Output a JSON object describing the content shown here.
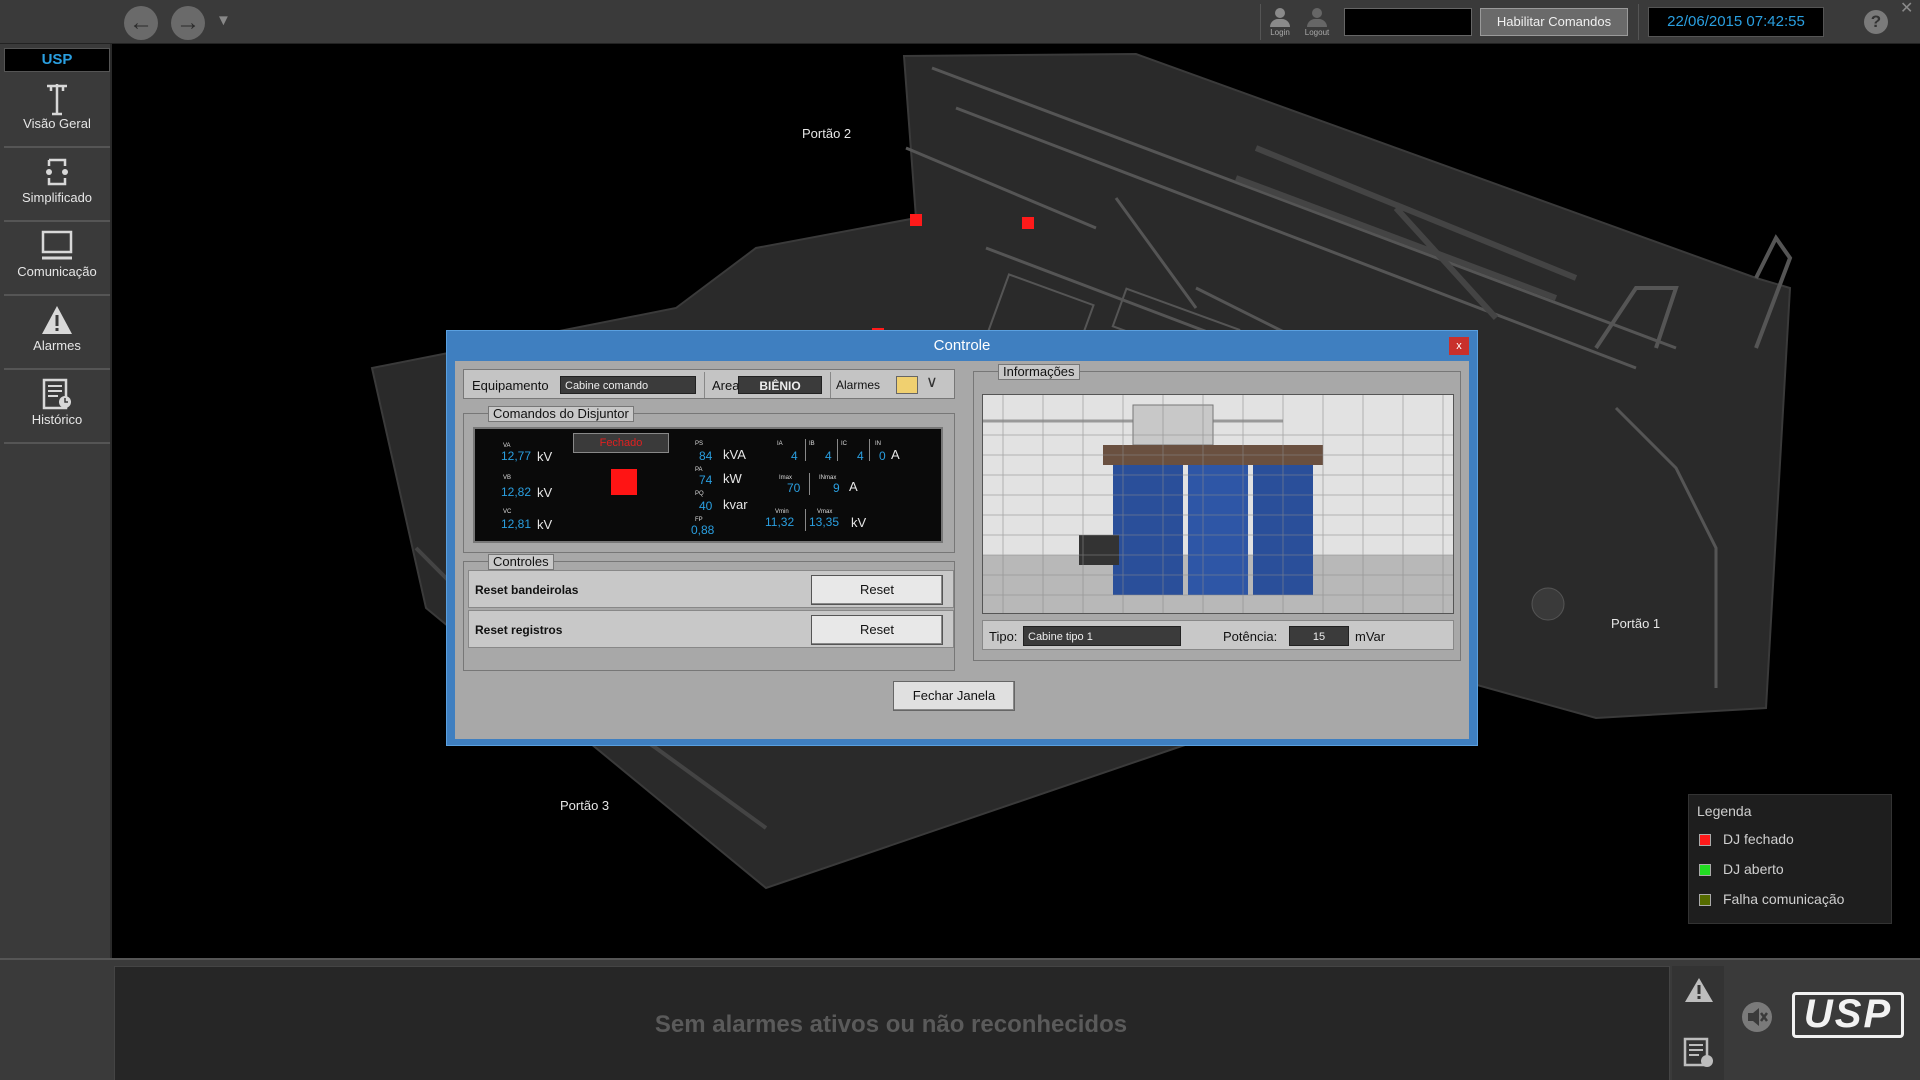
{
  "topbar": {
    "login_label": "Login",
    "logout_label": "Logout",
    "user_field_value": "",
    "habilitar_label": "Habilitar Comandos",
    "datetime": "22/06/2015 07:42:55",
    "help_label": "?"
  },
  "sidebar": {
    "area": "USP",
    "items": [
      {
        "label": "Visão Geral",
        "icon": "tower-icon"
      },
      {
        "label": "Simplificado",
        "icon": "diagram-icon"
      },
      {
        "label": "Comunicação",
        "icon": "monitor-icon"
      },
      {
        "label": "Alarmes",
        "icon": "warning-icon"
      },
      {
        "label": "Histórico",
        "icon": "history-icon"
      }
    ]
  },
  "map": {
    "labels": {
      "portao1": "Portão 1",
      "portao2": "Portão 2",
      "portao3": "Portão 3"
    },
    "closed_breaker_color": "#ff1a1a"
  },
  "legend": {
    "title": "Legenda",
    "items": [
      {
        "label": "DJ fechado",
        "color": "#ff1a1a"
      },
      {
        "label": "DJ aberto",
        "color": "#22dd22"
      },
      {
        "label": "Falha comunicação",
        "color": "#556b00"
      }
    ]
  },
  "dialog": {
    "title": "Controle",
    "close_label": "x",
    "equipamento_label": "Equipamento",
    "equipamento_value": "Cabine comando",
    "area_label": "Area",
    "area_value": "BIÊNIO",
    "alarmes_label": "Alarmes",
    "comandos_title": "Comandos do Disjuntor",
    "breaker_state": "Fechado",
    "measurements": {
      "va_label": "VA",
      "va": "12,77",
      "va_unit": "kV",
      "vb_label": "VB",
      "vb": "12,82",
      "vb_unit": "kV",
      "vc_label": "VC",
      "vc": "12,81",
      "vc_unit": "kV",
      "ps_label": "PS",
      "ps": "84",
      "ps_unit": "kVA",
      "pa_label": "PA",
      "pa": "74",
      "pa_unit": "kW",
      "pq_label": "PQ",
      "pq": "40",
      "pq_unit": "kvar",
      "fp_label": "FP",
      "fp": "0,88",
      "ia_label": "IA",
      "ia": "4",
      "ib_label": "IB",
      "ib": "4",
      "ic_label": "IC",
      "ic": "4",
      "in_label": "IN",
      "in": "0",
      "i_unit": "A",
      "imax_label": "Imax",
      "imax": "70",
      "inmax_label": "INmax",
      "inmax": "9",
      "imax_unit": "A",
      "vmin_label": "Vmin",
      "vmin": "11,32",
      "vmax_label": "Vmax",
      "vmax": "13,35",
      "v_unit": "kV"
    },
    "controles_title": "Controles",
    "controls": [
      {
        "label": "Reset bandeirolas",
        "button": "Reset"
      },
      {
        "label": "Reset registros",
        "button": "Reset"
      }
    ],
    "info_title": "Informações",
    "tipo_label": "Tipo:",
    "tipo_value": "Cabine tipo 1",
    "potencia_label": "Potência:",
    "potencia_value": "15",
    "potencia_unit": "mVar",
    "fechar_label": "Fechar Janela"
  },
  "alarmbar": {
    "message": "Sem alarmes ativos ou não reconhecidos",
    "logo_text": "USP"
  }
}
